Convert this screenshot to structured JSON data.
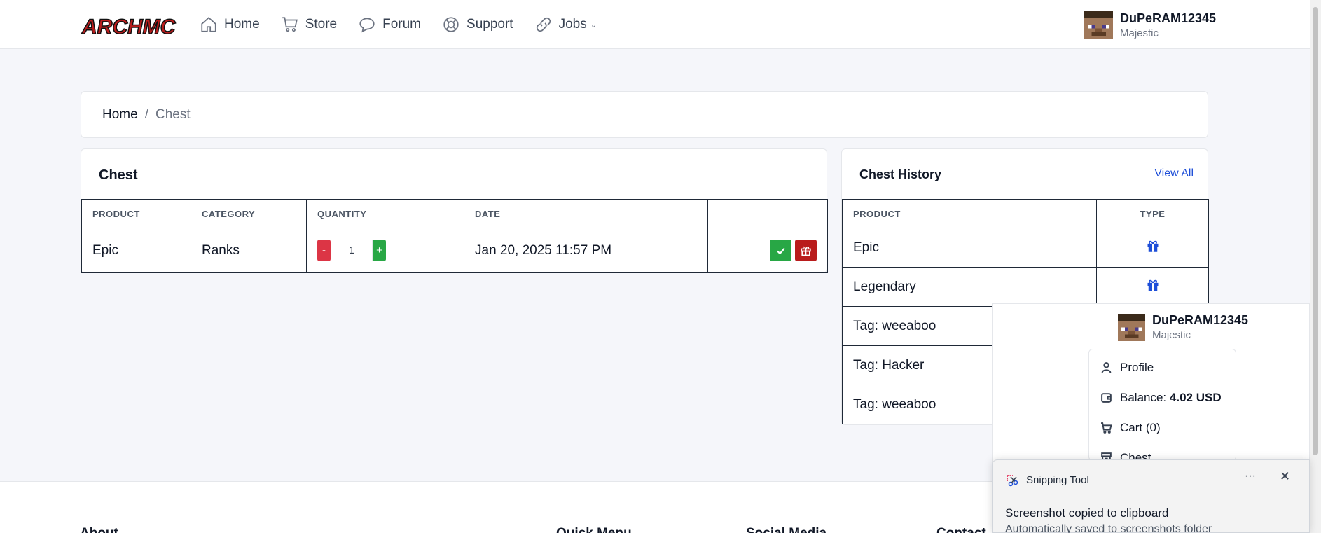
{
  "header": {
    "logo_text": "ARCHMC",
    "nav": [
      {
        "label": "Home",
        "icon": "home-icon"
      },
      {
        "label": "Store",
        "icon": "cart-icon"
      },
      {
        "label": "Forum",
        "icon": "chat-icon"
      },
      {
        "label": "Support",
        "icon": "lifebuoy-icon"
      },
      {
        "label": "Jobs",
        "icon": "link-icon"
      }
    ],
    "user": {
      "name": "DuPeRAM12345",
      "rank": "Majestic"
    }
  },
  "breadcrumb": {
    "home": "Home",
    "separator": "/",
    "current": "Chest"
  },
  "chest": {
    "title": "Chest",
    "columns": [
      "PRODUCT",
      "CATEGORY",
      "QUANTITY",
      "DATE",
      ""
    ],
    "rows": [
      {
        "product": "Epic",
        "category": "Ranks",
        "quantity": "1",
        "date": "Jan 20, 2025 11:57 PM",
        "minus": "-",
        "plus": "+"
      }
    ]
  },
  "history": {
    "title": "Chest History",
    "view_all": "View All",
    "columns": [
      "PRODUCT",
      "TYPE"
    ],
    "rows": [
      "Epic",
      "Legendary",
      "Tag: weeaboo",
      "Tag: Hacker",
      "Tag: weeaboo"
    ]
  },
  "dropdown": {
    "user": {
      "name": "DuPeRAM12345",
      "rank": "Majestic"
    },
    "items": {
      "profile": "Profile",
      "balance_label": "Balance:",
      "balance_value": "4.02 USD",
      "cart": "Cart (0)",
      "chest": "Chest"
    }
  },
  "footer": {
    "about": "About",
    "quick_menu": "Quick Menu",
    "social_media": "Social Media",
    "contact": "Contact"
  },
  "toast": {
    "app": "Snipping Tool",
    "more": "···",
    "close": "✕",
    "title": "Screenshot copied to clipboard",
    "subtitle": "Automatically saved to screenshots folder"
  },
  "colors": {
    "accent": "#1d4ed8",
    "success": "#28a745",
    "danger": "#dc3545",
    "gift": "#b91c1c"
  }
}
